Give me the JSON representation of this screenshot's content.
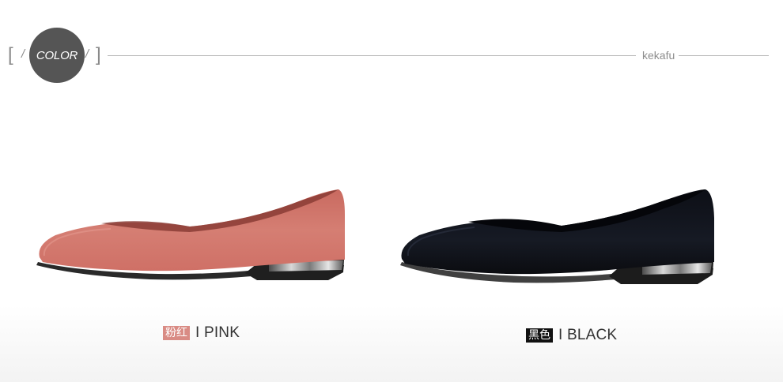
{
  "header": {
    "badge_label": "COLOR",
    "bracket_left": "[",
    "bracket_right": "]",
    "slash_left": "/",
    "slash_right": "/",
    "brand": "kekafu"
  },
  "products": [
    {
      "tag": "粉红",
      "label": "I PINK",
      "color": "#d98b84"
    },
    {
      "tag": "黑色",
      "label": "I BLACK",
      "color": "#111111"
    }
  ]
}
